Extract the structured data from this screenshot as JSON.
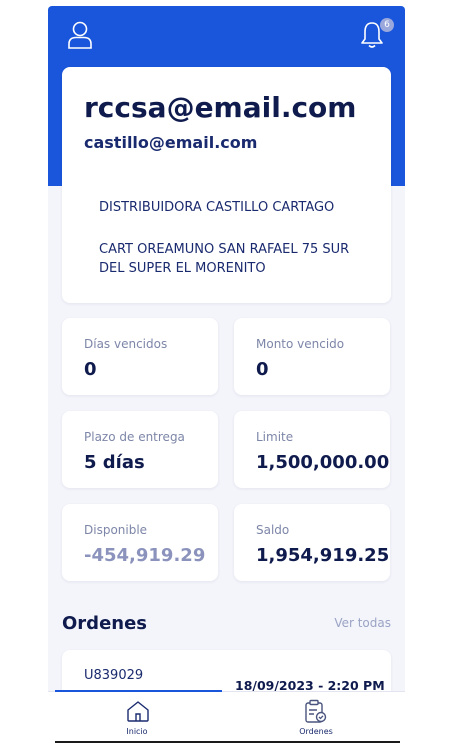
{
  "header": {
    "notification_count": "6"
  },
  "account": {
    "email_primary": "rccsa@email.com",
    "email_secondary": "castillo@email.com",
    "company_name": "DISTRIBUIDORA CASTILLO CARTAGO",
    "address": "CART OREAMUNO SAN RAFAEL 75 SUR DEL SUPER EL MORENITO"
  },
  "stats": [
    {
      "label": "Días vencidos",
      "value": "0"
    },
    {
      "label": "Monto vencido",
      "value": "0"
    },
    {
      "label": "Plazo de entrega",
      "value": "5 días"
    },
    {
      "label": "Limite",
      "value": "1,500,000.00"
    },
    {
      "label": "Disponible",
      "value": "-454,919.29"
    },
    {
      "label": "Saldo",
      "value": "1,954,919.25"
    }
  ],
  "orders": {
    "title": "Ordenes",
    "see_all": "Ver todas",
    "items": [
      {
        "id": "U839029",
        "date": "18/09/2023 - 2:20 PM"
      }
    ]
  },
  "tabs": [
    {
      "label": "Inicio",
      "icon": "home-icon",
      "active": true
    },
    {
      "label": "Ordenes",
      "icon": "clipboard-icon",
      "active": false
    }
  ],
  "colors": {
    "primary": "#1a56db",
    "text_dark": "#0f1a4d",
    "muted": "#8b93bd",
    "background": "#f4f5fb"
  }
}
